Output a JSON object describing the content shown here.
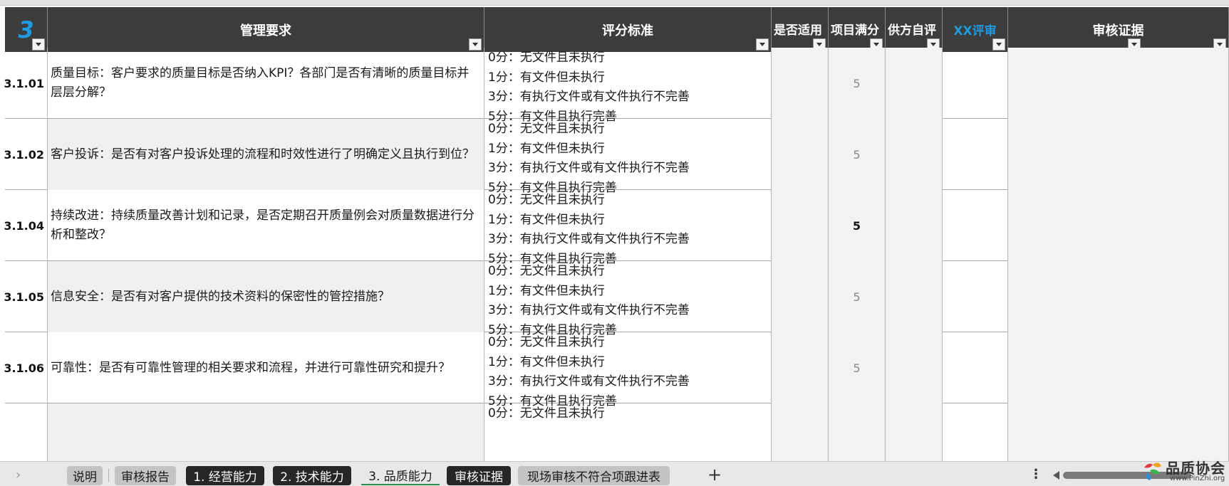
{
  "header": {
    "section_number": "3",
    "columns": [
      "管理要求",
      "评分标准",
      "是否适用",
      "项目满分",
      "供方自评",
      "XX评审",
      "审核证据"
    ]
  },
  "rows": [
    {
      "id": "3.1.01",
      "requirement": "质量目标：客户要求的质量目标是否纳入KPI？各部门是否有清晰的质量目标并层层分解？",
      "criteria": [
        "0分：无文件且未执行",
        "1分：有文件但未执行",
        "3分：有执行文件或有文件执行不完善",
        "5分：有文件且执行完善"
      ],
      "full_score": "5",
      "score_bold": false,
      "req_shaded": false
    },
    {
      "id": "3.1.02",
      "requirement": "客户投诉：是否有对客户投诉处理的流程和时效性进行了明确定义且执行到位？",
      "criteria": [
        "0分：无文件且未执行",
        "1分：有文件但未执行",
        "3分：有执行文件或有文件执行不完善",
        "5分：有文件且执行完善"
      ],
      "full_score": "5",
      "score_bold": false,
      "req_shaded": true
    },
    {
      "id": "3.1.04",
      "requirement": "持续改进：持续质量改善计划和记录，是否定期召开质量例会对质量数据进行分析和整改？",
      "criteria": [
        "0分：无文件且未执行",
        "1分：有文件但未执行",
        "3分：有执行文件或有文件执行不完善",
        "5分：有文件且执行完善"
      ],
      "full_score": "5",
      "score_bold": true,
      "req_shaded": false
    },
    {
      "id": "3.1.05",
      "requirement": "信息安全：是否有对客户提供的技术资料的保密性的管控措施？",
      "criteria": [
        "0分：无文件且未执行",
        "1分：有文件但未执行",
        "3分：有执行文件或有文件执行不完善",
        "5分：有文件且执行完善"
      ],
      "full_score": "5",
      "score_bold": false,
      "req_shaded": true
    },
    {
      "id": "3.1.06",
      "requirement": "可靠性：是否有可靠性管理的相关要求和流程，并进行可靠性研究和提升？",
      "criteria": [
        "0分：无文件且未执行",
        "1分：有文件但未执行",
        "3分：有执行文件或有文件执行不完善",
        "5分：有文件且执行完善"
      ],
      "full_score": "5",
      "score_bold": false,
      "req_shaded": false
    },
    {
      "id": "",
      "requirement": "",
      "criteria": [
        "0分：无文件且未执行"
      ],
      "full_score": "",
      "score_bold": false,
      "req_shaded": true
    }
  ],
  "tabs": [
    {
      "label": "说明",
      "style": "light"
    },
    {
      "label": "审核报告",
      "style": "light"
    },
    {
      "label": "1. 经营能力",
      "style": "dark"
    },
    {
      "label": "2. 技术能力",
      "style": "dark"
    },
    {
      "label": "3. 品质能力",
      "style": "active"
    },
    {
      "label": "审核证据",
      "style": "dark"
    },
    {
      "label": "现场审核不符合项跟进表",
      "style": "light"
    }
  ],
  "logo": {
    "title": "品质协会",
    "url": "www.PinZhi.org"
  },
  "colors": {
    "header_bg": "#3c3c3c",
    "accent_blue": "#1e9be0",
    "active_tab_underline": "#2f8f4e"
  }
}
